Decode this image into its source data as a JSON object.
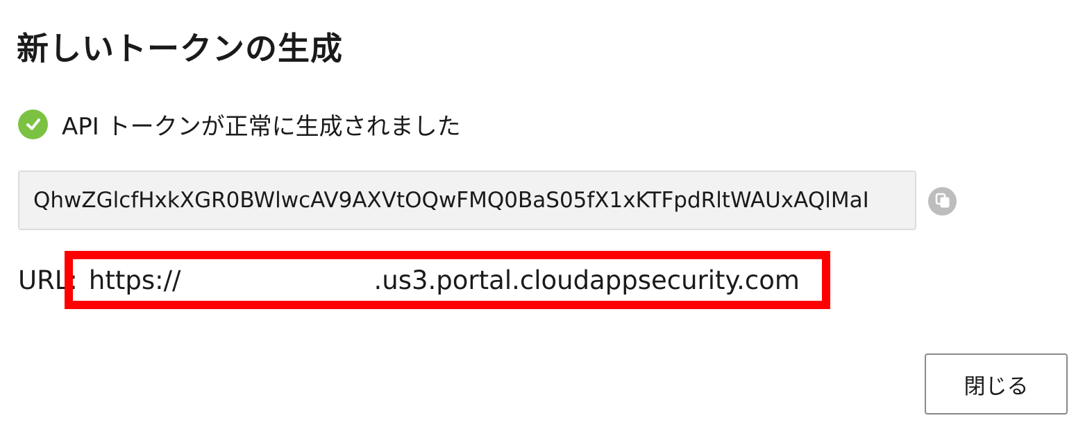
{
  "dialog": {
    "title": "新しいトークンの生成",
    "success_message": "API トークンが正常に生成されました",
    "token_value": "QhwZGlcfHxkXGR0BWlwcAV9AXVtOQwFMQ0BaS05fX1xKTFpdRltWAUxAQlMaI",
    "url_label": "URL:",
    "url_prefix": "https://",
    "url_suffix": ".us3.portal.cloudappsecurity.com",
    "close_label": "閉じる"
  },
  "colors": {
    "success": "#7cc242",
    "highlight": "#ff0000",
    "field_background": "#f2f2f2",
    "copy_icon": "#bdbdbd"
  },
  "icons": {
    "success": "check-circle-icon",
    "copy": "copy-icon"
  }
}
